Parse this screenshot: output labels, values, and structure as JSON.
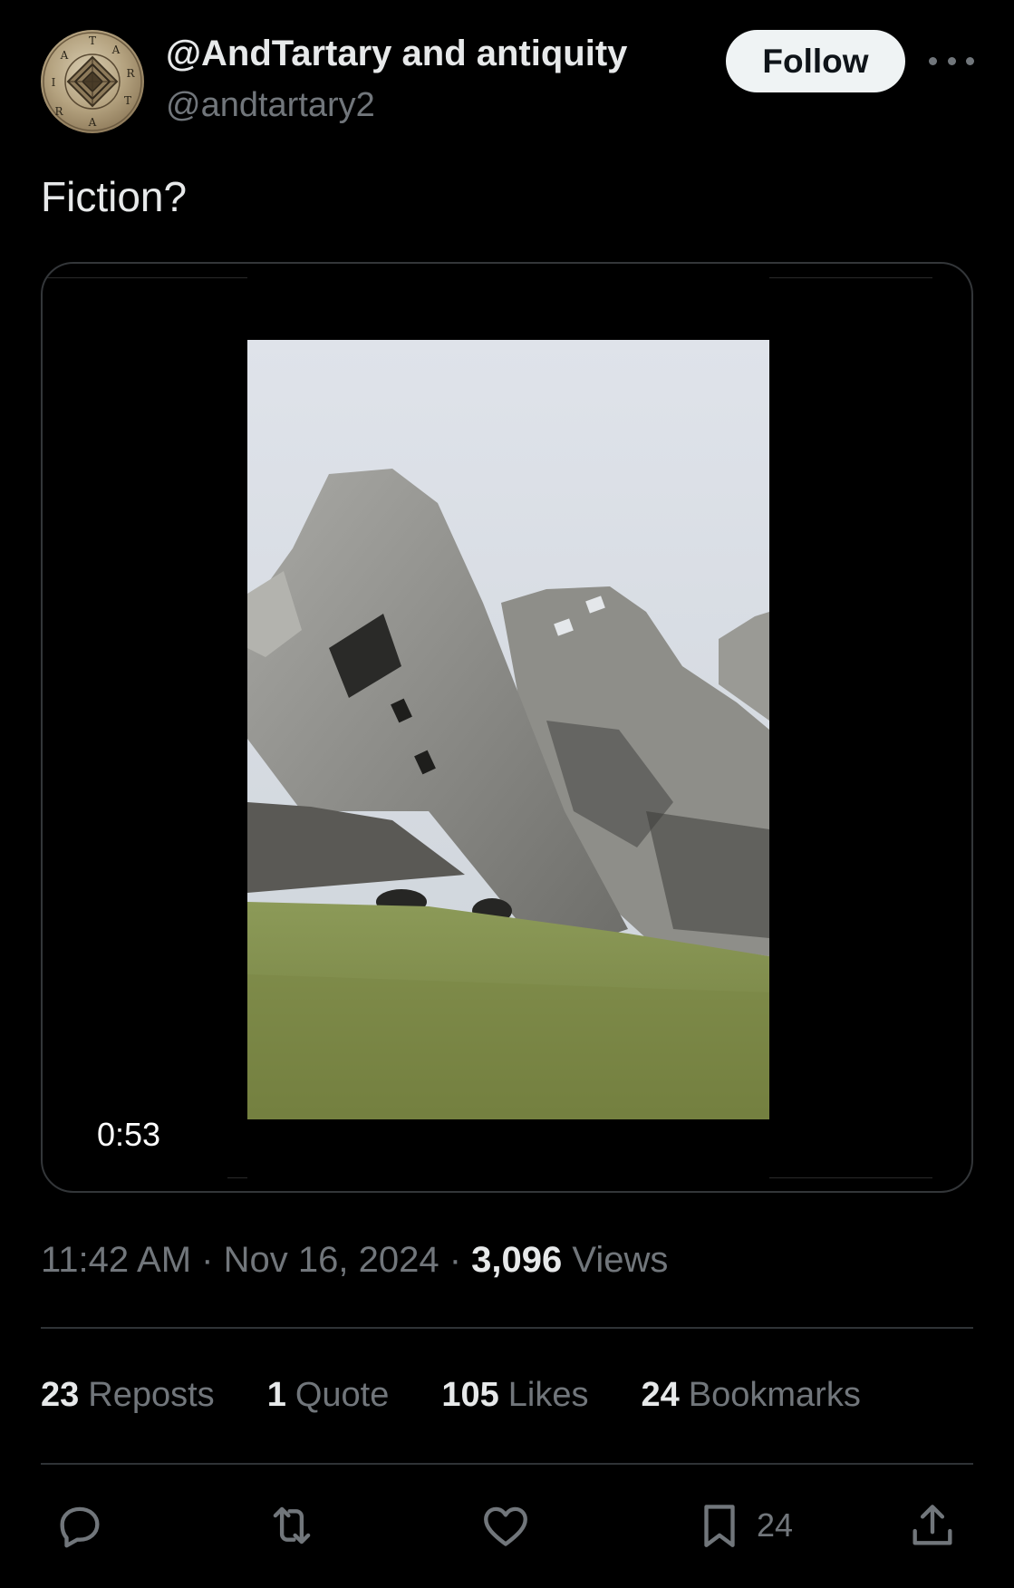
{
  "author": {
    "display_name": "@AndTartary and antiquity",
    "handle": "@andtartary2",
    "avatar_icon": "tartary-seal-avatar",
    "avatar_letters": "TARTARIA"
  },
  "header": {
    "follow_label": "Follow",
    "more_icon": "more-horizontal-icon"
  },
  "tweet": {
    "text": "Fiction?"
  },
  "media": {
    "duration": "0:53"
  },
  "meta": {
    "time": "11:42 AM",
    "separator": "·",
    "date": "Nov 16, 2024",
    "views_count": "3,096",
    "views_label": "Views"
  },
  "stats": [
    {
      "count": "23",
      "label": "Reposts"
    },
    {
      "count": "1",
      "label": "Quote"
    },
    {
      "count": "105",
      "label": "Likes"
    },
    {
      "count": "24",
      "label": "Bookmarks"
    }
  ],
  "actions": {
    "reply_icon": "reply-icon",
    "repost_icon": "repost-icon",
    "like_icon": "heart-icon",
    "bookmark_icon": "bookmark-icon",
    "bookmark_count": "24",
    "share_icon": "share-icon"
  },
  "colors": {
    "background": "#000000",
    "primary_text": "#e7e9ea",
    "secondary_text": "#71767b",
    "border": "#2f3336",
    "follow_bg": "#eff3f4"
  }
}
